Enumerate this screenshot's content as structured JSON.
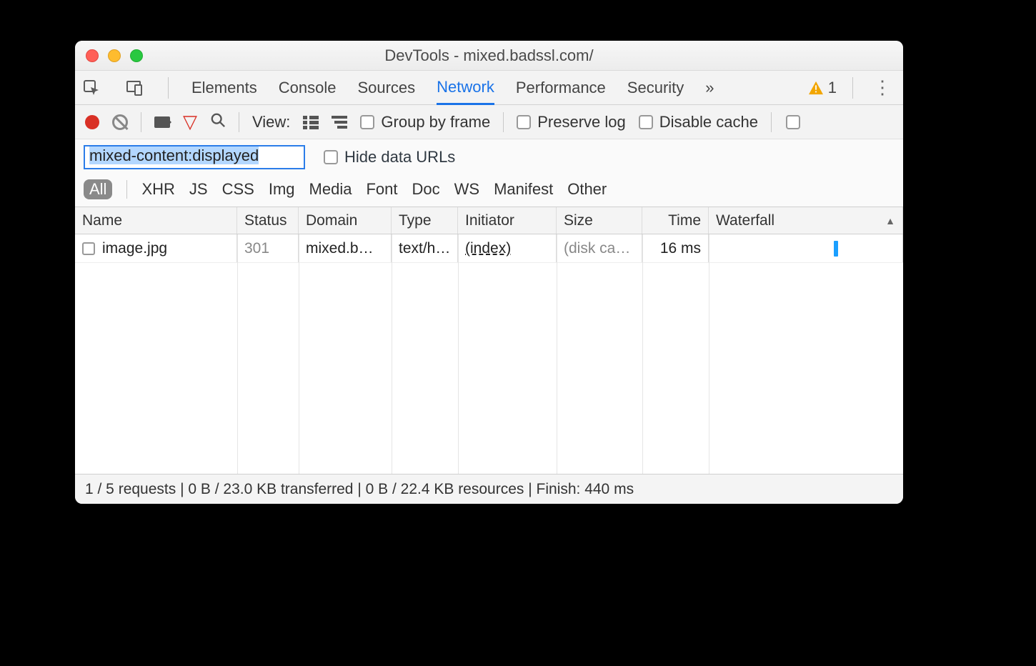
{
  "window": {
    "title": "DevTools - mixed.badssl.com/"
  },
  "tabs": {
    "items": [
      "Elements",
      "Console",
      "Sources",
      "Network",
      "Performance",
      "Security"
    ],
    "active": "Network",
    "warnings_count": "1"
  },
  "toolbar": {
    "view_label": "View:",
    "group_by_frame": "Group by frame",
    "preserve_log": "Preserve log",
    "disable_cache": "Disable cache"
  },
  "filter": {
    "value": "mixed-content:displayed",
    "hide_data_urls": "Hide data URLs"
  },
  "type_filters": [
    "All",
    "XHR",
    "JS",
    "CSS",
    "Img",
    "Media",
    "Font",
    "Doc",
    "WS",
    "Manifest",
    "Other"
  ],
  "type_active": "All",
  "columns": [
    "Name",
    "Status",
    "Domain",
    "Type",
    "Initiator",
    "Size",
    "Time",
    "Waterfall"
  ],
  "rows": [
    {
      "name": "image.jpg",
      "status": "301",
      "domain": "mixed.b…",
      "type": "text/h…",
      "initiator": "(index)",
      "size": "(disk ca…",
      "time": "16 ms"
    }
  ],
  "footer": {
    "text": "1 / 5 requests | 0 B / 23.0 KB transferred | 0 B / 22.4 KB resources | Finish: 440 ms"
  }
}
